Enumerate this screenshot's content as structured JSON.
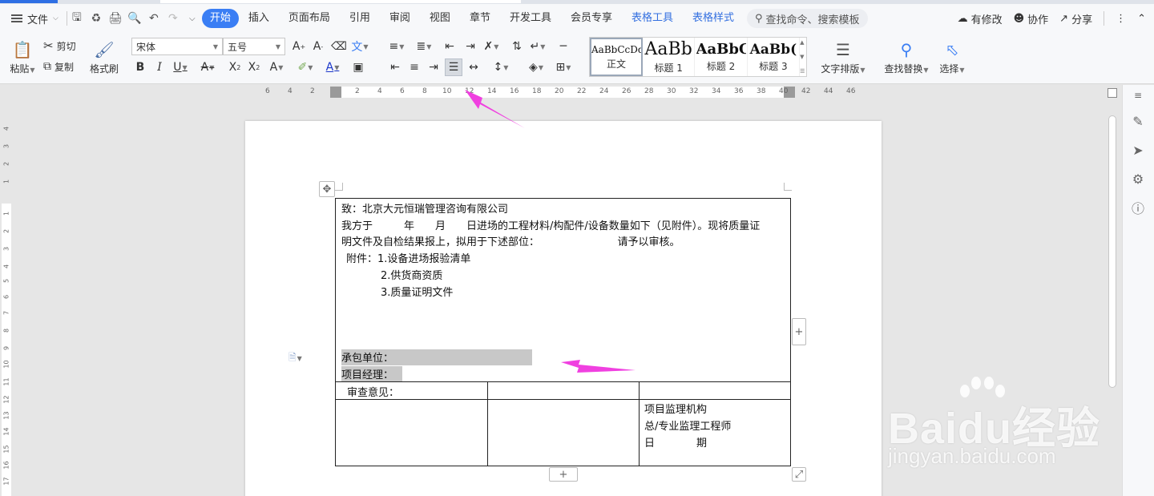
{
  "menubar": {
    "file_label": "文件",
    "tabs": [
      {
        "label": "开始",
        "active": true
      },
      {
        "label": "插入"
      },
      {
        "label": "页面布局"
      },
      {
        "label": "引用"
      },
      {
        "label": "审阅"
      },
      {
        "label": "视图"
      },
      {
        "label": "章节"
      },
      {
        "label": "开发工具"
      },
      {
        "label": "会员专享"
      },
      {
        "label": "表格工具",
        "contextual": true
      },
      {
        "label": "表格样式",
        "contextual": true
      }
    ],
    "search_placeholder": "查找命令、搜索模板",
    "right": {
      "modified": "有修改",
      "collab": "协作",
      "share": "分享"
    }
  },
  "ribbon": {
    "paste": "粘贴",
    "cut": "剪切",
    "copy": "复制",
    "format_painter": "格式刷",
    "font_name": "宋体",
    "font_size": "五号",
    "styles": [
      {
        "sample": "AaBbCcDd",
        "name": "正文"
      },
      {
        "sample": "AaBb",
        "name": "标题 1"
      },
      {
        "sample": "AaBbC",
        "name": "标题 2"
      },
      {
        "sample": "AaBb(",
        "name": "标题 3"
      }
    ],
    "text_layout": "文字排版",
    "find_replace": "查找替换",
    "select": "选择"
  },
  "ruler": {
    "ticks": [
      "6",
      "4",
      "2",
      "2",
      "4",
      "6",
      "8",
      "10",
      "12",
      "14",
      "16",
      "18",
      "20",
      "22",
      "24",
      "26",
      "28",
      "30",
      "32",
      "34",
      "36",
      "38",
      "40",
      "42",
      "44",
      "46"
    ],
    "vticks": [
      "4",
      "3",
      "2",
      "1",
      "1",
      "2",
      "3",
      "4",
      "5",
      "6",
      "7",
      "8",
      "9",
      "10",
      "11",
      "12",
      "13",
      "14",
      "15",
      "16",
      "17"
    ]
  },
  "document": {
    "line1": "致：北京大元恒瑞管理咨询有限公司",
    "line2": "我方于　　　年　　月　　日进场的工程材料/构配件/设备数量如下（见附件）。现将质量证",
    "line3": "明文件及自检结果报上，拟用于下述部位：　　　　　　　　请予以审核。",
    "attach_title": "附件：1.设备进场报验清单",
    "attach2": "2.供货商资质",
    "attach3": "3.质量证明文件",
    "contractor": "承包单位：",
    "pm": "项目经理：",
    "review": "审查意见：",
    "sup1": "项目监理机构",
    "sup2": "总/专业监理工程师",
    "sup3": "日　　　　期"
  },
  "watermark": {
    "brand": "Baidu经验",
    "url": "jingyan.baidu.com"
  },
  "colors": {
    "accent": "#3a7ef4",
    "arrow": "#f040e0",
    "ctx_tab": "#3470e0"
  }
}
